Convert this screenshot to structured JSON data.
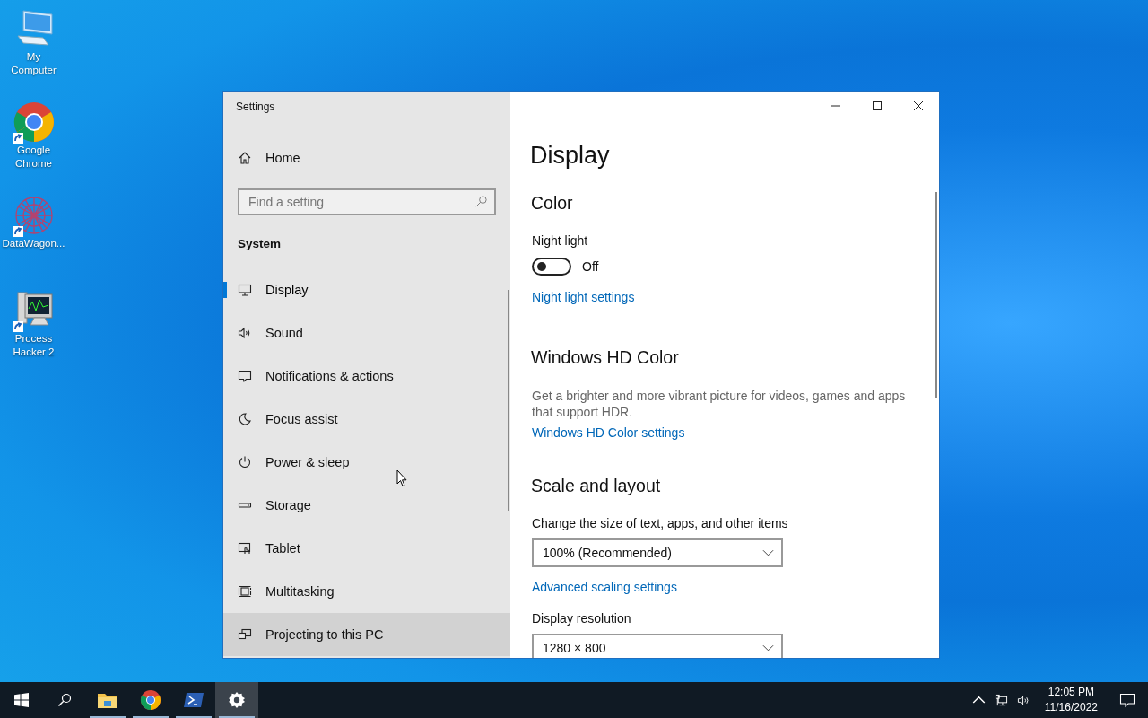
{
  "desktop_icons": [
    {
      "label": "My\nComputer",
      "shortcut": false
    },
    {
      "label": "Google\nChrome",
      "shortcut": true
    },
    {
      "label": "DataWagon...",
      "shortcut": true
    },
    {
      "label": "Process\nHacker 2",
      "shortcut": true
    }
  ],
  "window": {
    "title": "Settings"
  },
  "sidebar": {
    "home": "Home",
    "search": {
      "placeholder": "Find a setting"
    },
    "section": "System",
    "items": [
      {
        "label": "Display",
        "selected": true,
        "highlighted": false
      },
      {
        "label": "Sound",
        "selected": false,
        "highlighted": false
      },
      {
        "label": "Notifications & actions",
        "selected": false,
        "highlighted": false
      },
      {
        "label": "Focus assist",
        "selected": false,
        "highlighted": false
      },
      {
        "label": "Power & sleep",
        "selected": false,
        "highlighted": false
      },
      {
        "label": "Storage",
        "selected": false,
        "highlighted": false
      },
      {
        "label": "Tablet",
        "selected": false,
        "highlighted": false
      },
      {
        "label": "Multitasking",
        "selected": false,
        "highlighted": false
      },
      {
        "label": "Projecting to this PC",
        "selected": false,
        "highlighted": true
      }
    ]
  },
  "main": {
    "title": "Display",
    "color": {
      "heading": "Color",
      "night_light": {
        "label": "Night light",
        "on": false,
        "state_text": "Off"
      },
      "link": "Night light settings"
    },
    "hd_color": {
      "heading": "Windows HD Color",
      "description": "Get a brighter and more vibrant picture for videos, games and apps that support HDR.",
      "link": "Windows HD Color settings"
    },
    "scale": {
      "heading": "Scale and layout",
      "size_label": "Change the size of text, apps, and other items",
      "size_value": "100% (Recommended)",
      "link": "Advanced scaling settings",
      "resolution_label": "Display resolution",
      "resolution_value": "1280 × 800"
    }
  },
  "taskbar": {
    "apps": [
      {
        "kind": "explorer",
        "running": true,
        "selected": false
      },
      {
        "kind": "chrome",
        "running": true,
        "selected": false
      },
      {
        "kind": "powershell",
        "running": true,
        "selected": false
      },
      {
        "kind": "settings",
        "running": true,
        "selected": true
      }
    ],
    "time": "12:05 PM",
    "date": "11/16/2022"
  }
}
